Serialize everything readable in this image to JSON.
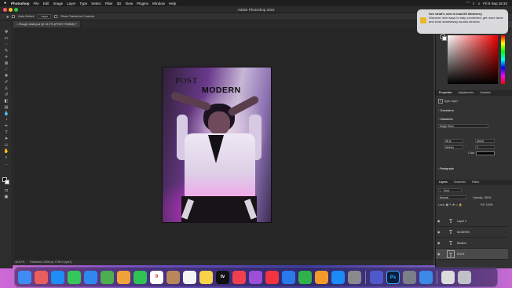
{
  "menubar": {
    "app": "Photoshop",
    "items": [
      "File",
      "Edit",
      "Image",
      "Layer",
      "Type",
      "Select",
      "Filter",
      "3D",
      "View",
      "Plugins",
      "Window",
      "Help"
    ],
    "clock": "Fri 9 Sep 16:34"
  },
  "window": {
    "title": "Adobe Photoshop 2022"
  },
  "options": {
    "auto_select_label": "Auto-Select:",
    "auto_select_value": "Layer",
    "transform_label": "Show Transform Controls"
  },
  "document": {
    "tab_title": "Rough draft.psd @ 16.7% (POST, RGB/8) *",
    "text_post": "POST",
    "text_modern": "MODERN"
  },
  "status": {
    "zoom": "16.67%",
    "info": "Exhibitor's 3508 px 7798 9 (sp#1)"
  },
  "notification": {
    "title": "See what's new in macOS Monterey",
    "body": "Discover new ways to stay connected, get more done and work seamlessly across devices."
  },
  "properties": {
    "tabs": [
      "Properties",
      "Adjustments",
      "Libraries"
    ],
    "layer_kind": "Type Layer",
    "section_transform": "Transform",
    "section_character": "Character",
    "font": "Magic Retro",
    "size": "48 pt",
    "leading": "(Auto)",
    "tracking": "Metrics",
    "kerning": "0",
    "color_label": "Color",
    "section_paragraph": "Paragraph"
  },
  "layers_panel": {
    "tabs": [
      "Layers",
      "Channels",
      "Paths"
    ],
    "filter": "Kind",
    "blend_mode": "Normal",
    "opacity_label": "Opacity:",
    "opacity": "100%",
    "lock_label": "Lock:",
    "fill_label": "Fill:",
    "fill": "100%",
    "layers": [
      {
        "name": "Layer 1",
        "kind": "T"
      },
      {
        "name": "MODERN",
        "kind": "T"
      },
      {
        "name": "Modern",
        "kind": "T"
      },
      {
        "name": "POST",
        "kind": "T"
      }
    ]
  },
  "dock": {
    "apps": [
      {
        "name": "finder-icon",
        "color": "#3d8df5",
        "glyph": ""
      },
      {
        "name": "launchpad-icon",
        "color": "#e85d5d",
        "glyph": ""
      },
      {
        "name": "safari-icon",
        "color": "#1e8ef7",
        "glyph": ""
      },
      {
        "name": "messages-icon",
        "color": "#34c759",
        "glyph": ""
      },
      {
        "name": "mail-icon",
        "color": "#2f88f0",
        "glyph": ""
      },
      {
        "name": "maps-icon",
        "color": "#4cae50",
        "glyph": ""
      },
      {
        "name": "photos-icon",
        "color": "#f2a23b",
        "glyph": ""
      },
      {
        "name": "facetime-icon",
        "color": "#2fc254",
        "glyph": ""
      },
      {
        "name": "calendar-icon",
        "color": "#ffffff",
        "glyph": "9"
      },
      {
        "name": "contacts-icon",
        "color": "#b8875a",
        "glyph": ""
      },
      {
        "name": "reminders-icon",
        "color": "#f4f4f4",
        "glyph": ""
      },
      {
        "name": "notes-icon",
        "color": "#f7d24a",
        "glyph": ""
      },
      {
        "name": "appletv-icon",
        "color": "#111111",
        "glyph": "tv"
      },
      {
        "name": "music-icon",
        "color": "#f0404d",
        "glyph": ""
      },
      {
        "name": "podcasts-icon",
        "color": "#9b4fd6",
        "glyph": ""
      },
      {
        "name": "news-icon",
        "color": "#f2343f",
        "glyph": ""
      },
      {
        "name": "keynote-icon",
        "color": "#2a79ea",
        "glyph": ""
      },
      {
        "name": "numbers-icon",
        "color": "#2fb24a",
        "glyph": ""
      },
      {
        "name": "pages-icon",
        "color": "#f39a2a",
        "glyph": ""
      },
      {
        "name": "appstore-icon",
        "color": "#1b8cf3",
        "glyph": ""
      },
      {
        "name": "settings-icon",
        "color": "#8a8a8e",
        "glyph": ""
      },
      {
        "name": "teams-icon",
        "color": "#5059c9",
        "glyph": ""
      },
      {
        "name": "photoshop-icon",
        "color": "#0b1e3a",
        "glyph": "Ps"
      },
      {
        "name": "preview-icon",
        "color": "#7a7f88",
        "glyph": ""
      },
      {
        "name": "downloads-icon",
        "color": "#3b8ae6",
        "glyph": ""
      },
      {
        "name": "window-icon",
        "color": "#dcdcdc",
        "glyph": ""
      },
      {
        "name": "trash-icon",
        "color": "#bfc3c8",
        "glyph": ""
      }
    ]
  }
}
